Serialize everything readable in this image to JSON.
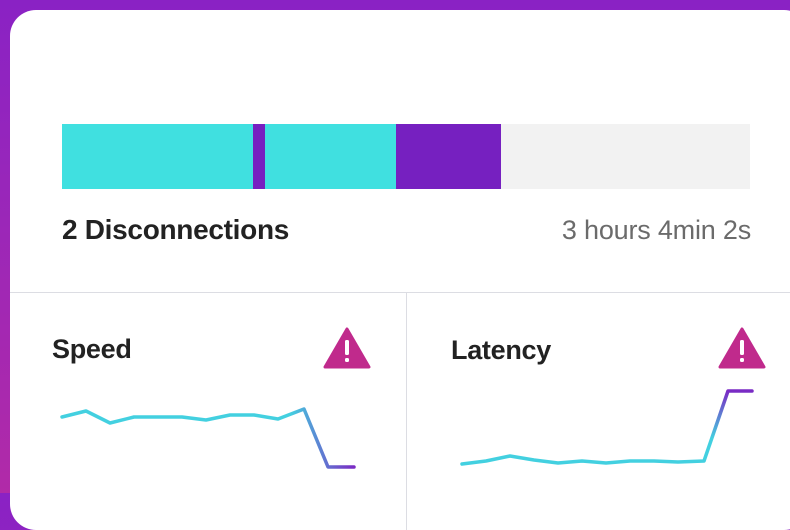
{
  "connection": {
    "disconnections_label": "2 Disconnections",
    "duration_label": "3 hours 4min 2s",
    "timeline_segments": [
      {
        "state": "connected",
        "start": 0.0,
        "end": 0.277
      },
      {
        "state": "disconnected",
        "start": 0.277,
        "end": 0.295
      },
      {
        "state": "connected",
        "start": 0.295,
        "end": 0.485
      },
      {
        "state": "disconnected",
        "start": 0.485,
        "end": 0.638
      }
    ]
  },
  "metrics": [
    {
      "id": "speed",
      "title": "Speed",
      "warning_icon": "warning-triangle-icon"
    },
    {
      "id": "latency",
      "title": "Latency",
      "warning_icon": "warning-triangle-icon"
    }
  ],
  "colors": {
    "connected": "#40e0e0",
    "disconnected": "#7620c0",
    "empty_track": "#f2f2f2",
    "warning": "#c02a8c",
    "spark_start": "#43d0e0",
    "spark_end": "#7a2ac4"
  }
}
